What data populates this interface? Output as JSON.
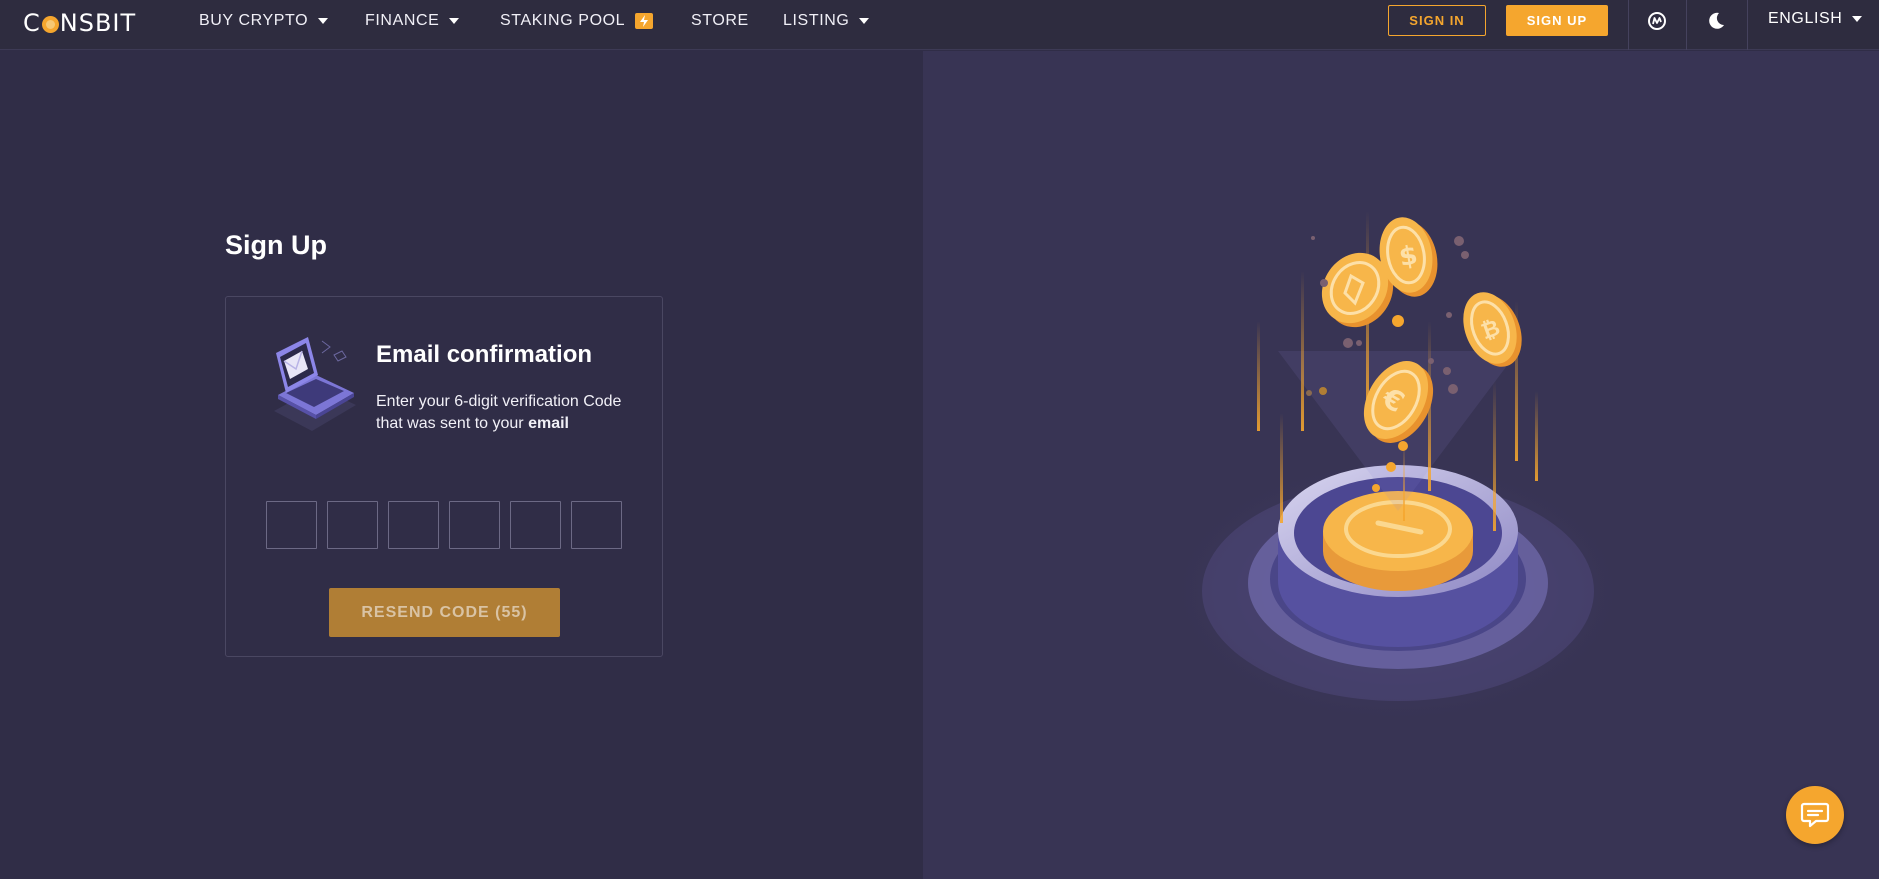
{
  "brand": {
    "name_prefix": "C",
    "name_suffix": "NSBIT"
  },
  "nav": {
    "items": [
      {
        "label": "BUY CRYPTO",
        "dropdown": true
      },
      {
        "label": "FINANCE",
        "dropdown": true
      },
      {
        "label": "STAKING POOL",
        "badge_icon": "lightning-icon"
      },
      {
        "label": "STORE"
      },
      {
        "label": "LISTING",
        "dropdown": true
      }
    ],
    "signin_label": "SIGN IN",
    "signup_label": "SIGN UP",
    "language": "ENGLISH",
    "icons": [
      "coinmarketcap-icon",
      "moon-icon",
      "chevron-down-icon"
    ]
  },
  "page": {
    "title": "Sign Up",
    "card": {
      "title": "Email confirmation",
      "desc_line1": "Enter your 6-digit verification Code",
      "desc_line2_prefix": "that was sent to your ",
      "desc_line2_bold": "email",
      "code_inputs": [
        "",
        "",
        "",
        "",
        "",
        ""
      ],
      "resend_label": "RESEND CODE (55)"
    }
  },
  "colors": {
    "accent": "#f5a62e",
    "background": "#302d47",
    "panel_right": "#383454",
    "nav": "#2e2c3f"
  }
}
